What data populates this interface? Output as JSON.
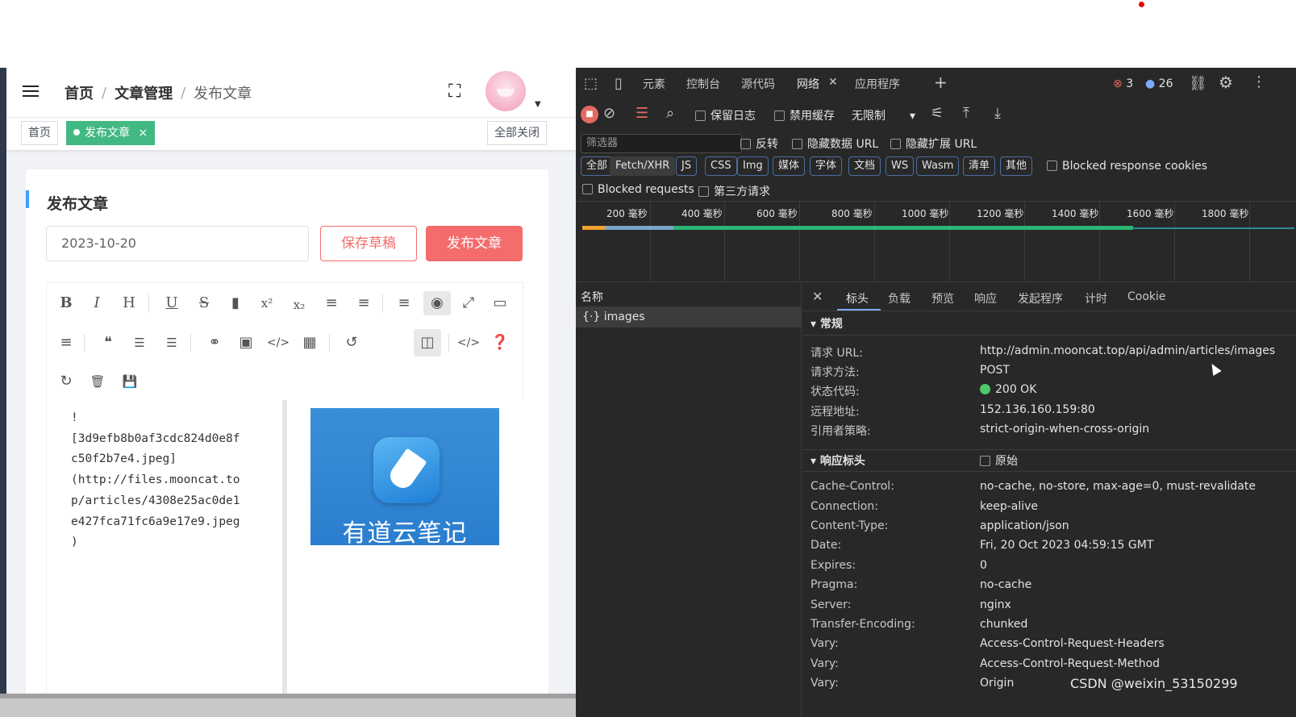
{
  "app": {
    "breadcrumb": {
      "home": "首页",
      "sep": "/",
      "section": "文章管理",
      "current": "发布文章"
    },
    "tags": {
      "home": "首页",
      "active": "发布文章",
      "close_all": "全部关闭"
    },
    "card": {
      "title": "发布文章",
      "date_value": "2023-10-20",
      "save_draft": "保存草稿",
      "publish": "发布文章"
    },
    "editor": {
      "markdown_text": "!\n[3d9efb8b0af3cdc824d0e8f\nc50f2b7e4.jpeg]\n(http://files.mooncat.to\np/articles/4308e25ac0de1\ne427fca71fc6a9e17e9.jpeg\n)",
      "preview_image_text": "有道云笔记"
    }
  },
  "devtools": {
    "tabs": [
      "元素",
      "控制台",
      "源代码",
      "网络",
      "应用程序"
    ],
    "errors": "3",
    "messages": "26",
    "toolbar": {
      "preserve_log": "保留日志",
      "disable_cache": "禁用缓存",
      "throttle": "无限制"
    },
    "filter": {
      "placeholder": "筛选器",
      "invert": "反转",
      "hide_data_url": "隐藏数据 URL",
      "hide_ext_url": "隐藏扩展 URL"
    },
    "chips": [
      "全部",
      "Fetch/XHR",
      "JS",
      "CSS",
      "Img",
      "媒体",
      "字体",
      "文档",
      "WS",
      "Wasm",
      "清单",
      "其他"
    ],
    "blocked_cookies": "Blocked response cookies",
    "blocked_requests": "Blocked requests",
    "third_party": "第三方请求",
    "ticks": [
      "200 毫秒",
      "400 毫秒",
      "600 毫秒",
      "800 毫秒",
      "1000 毫秒",
      "1200 毫秒",
      "1400 毫秒",
      "1600 毫秒",
      "1800 毫秒"
    ],
    "name_header": "名称",
    "request_name": "images",
    "detail_tabs": [
      "标头",
      "负载",
      "预览",
      "响应",
      "发起程序",
      "计时",
      "Cookie"
    ],
    "general": {
      "title": "常规",
      "rows": [
        {
          "k": "请求 URL:",
          "v": "http://admin.mooncat.top/api/admin/articles/images"
        },
        {
          "k": "请求方法:",
          "v": "POST"
        },
        {
          "k": "状态代码:",
          "v": "200 OK"
        },
        {
          "k": "远程地址:",
          "v": "152.136.160.159:80"
        },
        {
          "k": "引用者策略:",
          "v": "strict-origin-when-cross-origin"
        }
      ]
    },
    "response_headers": {
      "title": "响应标头",
      "raw": "原始",
      "rows": [
        {
          "k": "Cache-Control:",
          "v": "no-cache, no-store, max-age=0, must-revalidate"
        },
        {
          "k": "Connection:",
          "v": "keep-alive"
        },
        {
          "k": "Content-Type:",
          "v": "application/json"
        },
        {
          "k": "Date:",
          "v": "Fri, 20 Oct 2023 04:59:15 GMT"
        },
        {
          "k": "Expires:",
          "v": "0"
        },
        {
          "k": "Pragma:",
          "v": "no-cache"
        },
        {
          "k": "Server:",
          "v": "nginx"
        },
        {
          "k": "Transfer-Encoding:",
          "v": "chunked"
        },
        {
          "k": "Vary:",
          "v": "Access-Control-Request-Headers"
        },
        {
          "k": "Vary:",
          "v": "Access-Control-Request-Method"
        },
        {
          "k": "Vary:",
          "v": "Origin"
        }
      ]
    }
  },
  "watermark": "CSDN @weixin_53150299"
}
